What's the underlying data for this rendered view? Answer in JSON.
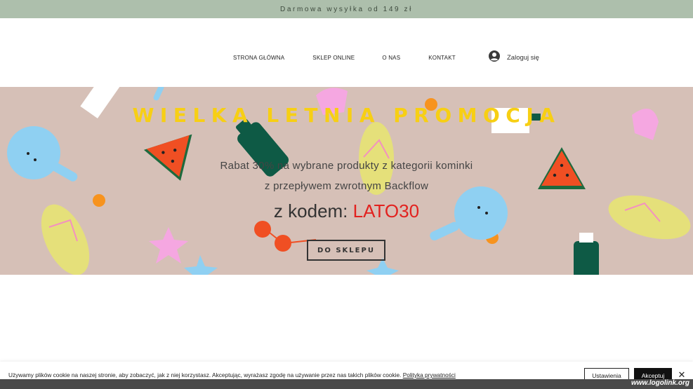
{
  "announcement": {
    "text": "Darmowa wysyłka od 149 zł"
  },
  "nav": {
    "items": [
      {
        "label": "STRONA GŁÓWNA"
      },
      {
        "label": "SKLEP ONLINE"
      },
      {
        "label": "O NAS"
      },
      {
        "label": "KONTAKT"
      }
    ]
  },
  "login": {
    "label": "Zaloguj się",
    "icon": "user-avatar-icon"
  },
  "hero": {
    "title": "WIELKA LETNIA PROMOCJA",
    "line1": "Rabat 30% na wybrane produkty z kategorii kominki",
    "line2": "z przepływem zwrotnym Backflow",
    "code_prefix": "z kodem: ",
    "code": "LATO30",
    "button": "DO SKLEPU",
    "colors": {
      "background": "#d6c0b7",
      "title": "#f7cf14",
      "code": "#e2221f"
    }
  },
  "cookie": {
    "text": "Używamy plików cookie na naszej stronie, aby zobaczyć, jak z niej korzystasz. Akceptując, wyrażasz zgodę na używanie przez nas takich plików cookie.",
    "policy_link": "Polityka prywatności",
    "settings_button": "Ustawienia",
    "accept_button": "Akceptuj",
    "close_icon": "close-icon"
  },
  "watermark": "www.logolink.org"
}
